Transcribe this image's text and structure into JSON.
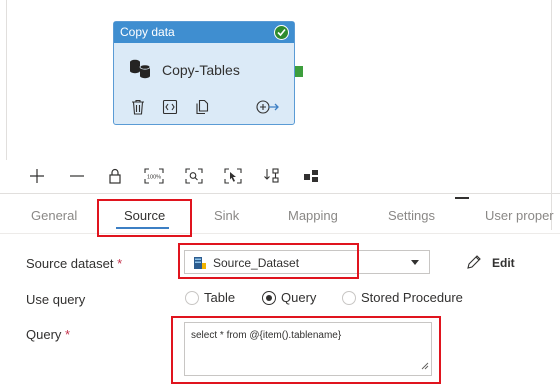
{
  "activity": {
    "header": "Copy data",
    "name": "Copy-Tables",
    "status_icon": "check-icon"
  },
  "toolbar": {
    "icons": [
      "add-icon",
      "remove-icon",
      "lock-icon",
      "zoom-100-icon",
      "zoom-to-fit-icon",
      "select-icon",
      "auto-align-icon",
      "layout-icon"
    ],
    "zoom_100_label": "100%"
  },
  "tabs": [
    {
      "label": "General"
    },
    {
      "label": "Source"
    },
    {
      "label": "Sink"
    },
    {
      "label": "Mapping"
    },
    {
      "label": "Settings"
    },
    {
      "label": "User proper"
    }
  ],
  "active_tab": "Source",
  "form": {
    "source_dataset": {
      "label": "Source dataset",
      "required_mark": "*",
      "value": "Source_Dataset",
      "edit_label": "Edit"
    },
    "use_query": {
      "label": "Use query",
      "options": [
        "Table",
        "Query",
        "Stored Procedure"
      ],
      "selected": "Query"
    },
    "query": {
      "label": "Query",
      "required_mark": "*",
      "value": "select * from @{item().tablename}"
    }
  },
  "colors": {
    "activity_header": "#3f8ed0",
    "activity_body": "#dbeaf7",
    "success": "#2e8b2e",
    "highlight": "#e0141e",
    "tab_accent": "#3c7fc4"
  }
}
